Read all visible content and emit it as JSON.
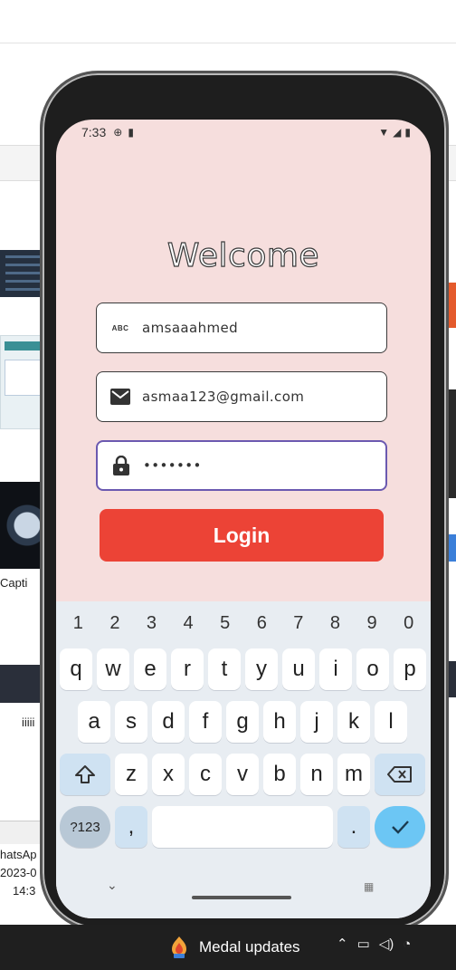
{
  "desktop": {
    "labels": [
      "Capti",
      "iiiii",
      "hatsAp",
      "2023-0",
      "14:3"
    ]
  },
  "status_bar": {
    "time": "7:33"
  },
  "login": {
    "title": "Welcome",
    "username": {
      "icon": "abc-icon",
      "icon_text": "ABC",
      "value": "amsaaahmed"
    },
    "email": {
      "icon": "email-icon",
      "value": "asmaa123@gmail.com"
    },
    "password": {
      "icon": "lock-icon",
      "value": "•••••••"
    },
    "button_label": "Login",
    "button_color": "#ec4336",
    "background": "#f6dedd"
  },
  "keyboard": {
    "numbers": [
      "1",
      "2",
      "3",
      "4",
      "5",
      "6",
      "7",
      "8",
      "9",
      "0"
    ],
    "row1": [
      "q",
      "w",
      "e",
      "r",
      "t",
      "y",
      "u",
      "i",
      "o",
      "p"
    ],
    "row2": [
      "a",
      "s",
      "d",
      "f",
      "g",
      "h",
      "j",
      "k",
      "l"
    ],
    "row3": [
      "z",
      "x",
      "c",
      "v",
      "b",
      "n",
      "m"
    ],
    "symbols_label": "?123",
    "comma": ",",
    "period": ".",
    "accent": "#6cc6f4"
  },
  "taskbar": {
    "notification": "Medal updates"
  }
}
